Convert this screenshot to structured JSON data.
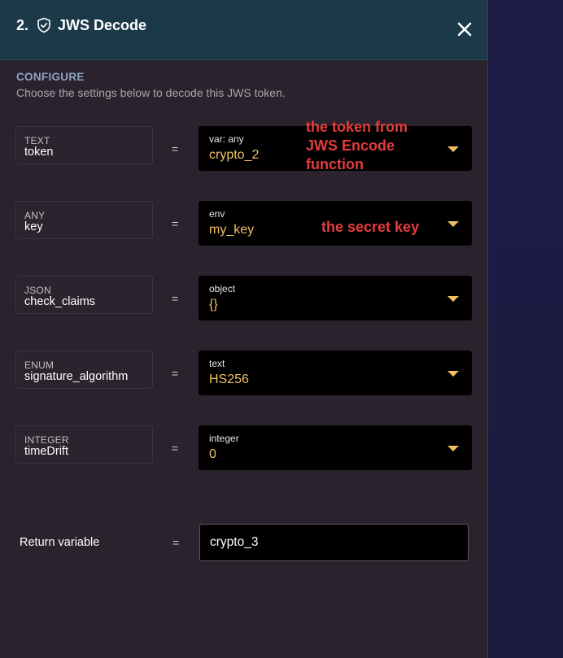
{
  "header": {
    "step": "2.",
    "icon": "shield-check-icon",
    "title": "JWS Decode",
    "close_icon": "close-icon"
  },
  "configure": {
    "label": "CONFIGURE",
    "description": "Choose the settings below to decode this JWS token."
  },
  "params": [
    {
      "type": "TEXT",
      "name": "token",
      "value_type": "var: any",
      "value": "crypto_2"
    },
    {
      "type": "ANY",
      "name": "key",
      "value_type": "env",
      "value": "my_key"
    },
    {
      "type": "JSON",
      "name": "check_claims",
      "value_type": "object",
      "value": "{}"
    },
    {
      "type": "ENUM",
      "name": "signature_algorithm",
      "value_type": "text",
      "value": "HS256"
    },
    {
      "type": "INTEGER",
      "name": "timeDrift",
      "value_type": "integer",
      "value": "0"
    }
  ],
  "equals": "=",
  "annotations": {
    "token_note_line1": "the token from",
    "token_note_line2": "JWS Encode",
    "token_note_line3": "function",
    "key_note": "the secret key"
  },
  "return": {
    "label": "Return variable",
    "value": "crypto_3"
  },
  "colors": {
    "header_bg": "#1c3949",
    "panel_bg": "#2a232d",
    "value_accent": "#f0c060",
    "annotation": "#e43c3c",
    "side_bg": "#1c1a3f"
  }
}
